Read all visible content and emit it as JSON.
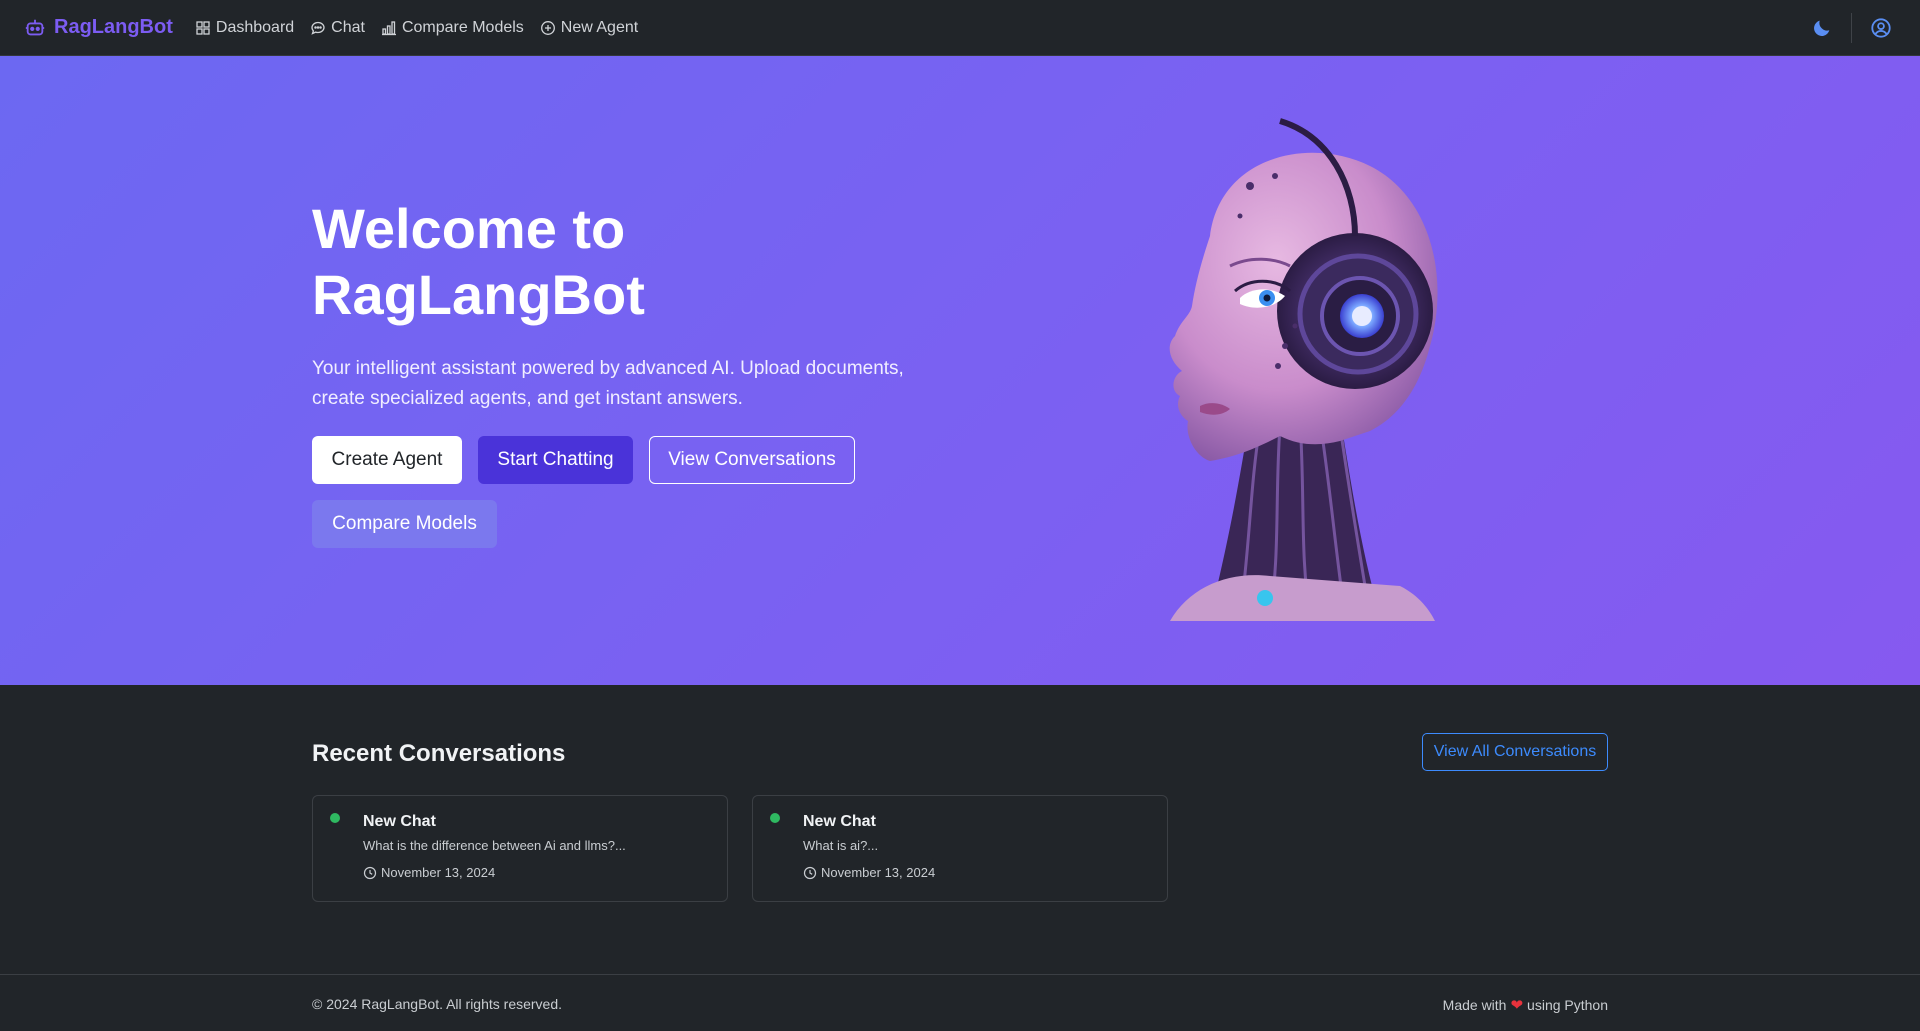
{
  "nav": {
    "brand": "RagLangBot",
    "links": [
      {
        "label": "Dashboard",
        "icon": "grid-icon"
      },
      {
        "label": "Chat",
        "icon": "chat-bubble-icon"
      },
      {
        "label": "Compare Models",
        "icon": "bar-chart-icon"
      },
      {
        "label": "New Agent",
        "icon": "plus-circle-icon"
      }
    ],
    "theme_icon": "moon-icon",
    "user_icon": "user-circle-icon"
  },
  "hero": {
    "title_line1": "Welcome to",
    "title_line2": "RagLangBot",
    "subtitle": "Your intelligent assistant powered by advanced AI. Upload documents, create specialized agents, and get instant answers.",
    "buttons": {
      "create_agent": "Create Agent",
      "start_chatting": "Start Chatting",
      "view_conversations": "View Conversations",
      "compare_models": "Compare Models"
    }
  },
  "recent": {
    "title": "Recent Conversations",
    "view_all": "View All Conversations",
    "conversations": [
      {
        "title": "New Chat",
        "preview": "What is the difference between Ai and llms?...",
        "date": "November 13, 2024"
      },
      {
        "title": "New Chat",
        "preview": "What is ai?...",
        "date": "November 13, 2024"
      }
    ]
  },
  "footer": {
    "copyright": "© 2024 RagLangBot. All rights reserved.",
    "made_prefix": "Made with",
    "made_suffix": "using Python"
  },
  "colors": {
    "brand": "#7c5cf2",
    "hero_start": "#6c68f2",
    "hero_end": "#8659f0",
    "status_dot": "#2fb961",
    "link_blue": "#3d8bfd"
  }
}
